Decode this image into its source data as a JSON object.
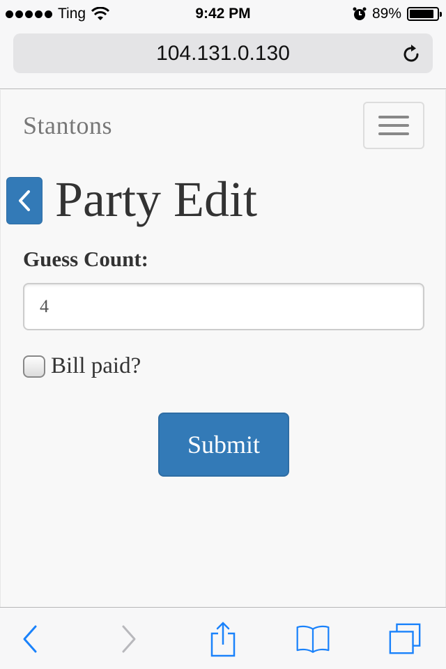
{
  "status_bar": {
    "carrier": "Ting",
    "time": "9:42 PM",
    "battery": "89%",
    "battery_level": 0.89,
    "icons": [
      "signal-dots-icon",
      "wifi-icon",
      "alarm-icon",
      "battery-icon"
    ]
  },
  "browser": {
    "url": "104.131.0.130",
    "icons": [
      "reload-icon"
    ]
  },
  "navbar": {
    "brand": "Stantons",
    "toggle_icon": "hamburger-menu-icon"
  },
  "main": {
    "back_icon": "chevron-left-icon",
    "title": "Party Edit",
    "guess_count_label": "Guess Count:",
    "guess_count_value": "4",
    "bill_paid_label": "Bill paid?",
    "bill_paid_checked": false,
    "submit_label": "Submit"
  },
  "toolbar": {
    "icons": [
      "back-arrow-icon",
      "forward-arrow-icon",
      "share-icon",
      "bookmarks-icon",
      "tabs-icon"
    ]
  },
  "colors": {
    "primary": "#337ab7",
    "ios_blue": "#1a82fb",
    "brand_text": "#777777",
    "heading_text": "#333333"
  }
}
